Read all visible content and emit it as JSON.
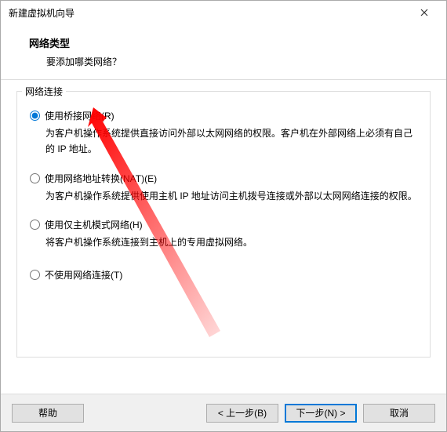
{
  "window": {
    "title": "新建虚拟机向导"
  },
  "header": {
    "title": "网络类型",
    "subtitle": "要添加哪类网络？"
  },
  "group": {
    "legend": "网络连接",
    "options": [
      {
        "label": "使用桥接网络(R)",
        "desc": "为客户机操作系统提供直接访问外部以太网网络的权限。客户机在外部网络上必须有自己的 IP 地址。",
        "selected": true
      },
      {
        "label": "使用网络地址转换(NAT)(E)",
        "desc": "为客户机操作系统提供使用主机 IP 地址访问主机拨号连接或外部以太网网络连接的权限。",
        "selected": false
      },
      {
        "label": "使用仅主机模式网络(H)",
        "desc": "将客户机操作系统连接到主机上的专用虚拟网络。",
        "selected": false
      },
      {
        "label": "不使用网络连接(T)",
        "desc": "",
        "selected": false
      }
    ]
  },
  "footer": {
    "help": "帮助",
    "back": "< 上一步(B)",
    "next": "下一步(N) >",
    "cancel": "取消"
  }
}
